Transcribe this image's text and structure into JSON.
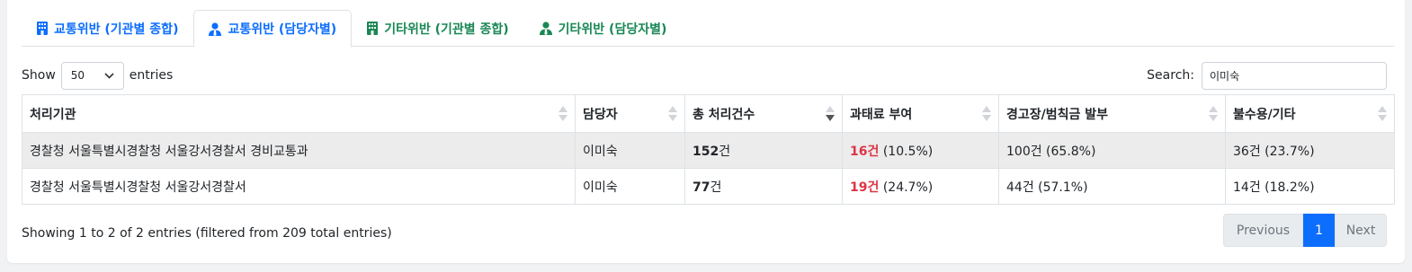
{
  "tabs": [
    {
      "label": "교통위반 (기관별 종합)",
      "icon": "building-icon",
      "color": "#0d6efd",
      "active": false
    },
    {
      "label": "교통위반 (담당자별)",
      "icon": "user-tie-icon",
      "color": "#0d6efd",
      "active": true
    },
    {
      "label": "기타위반 (기관별 종합)",
      "icon": "building-icon",
      "color": "#198754",
      "active": false
    },
    {
      "label": "기타위반 (담당자별)",
      "icon": "user-tie-icon",
      "color": "#198754",
      "active": false
    }
  ],
  "length": {
    "show": "Show",
    "value": "50",
    "entries": "entries"
  },
  "search": {
    "label": "Search:",
    "value": "이미숙"
  },
  "table": {
    "columns": [
      "처리기관",
      "담당자",
      "총 처리건수",
      "과태료 부여",
      "경고장/범칙금 발부",
      "불수용/기타"
    ],
    "sorted_column": "총 처리건수",
    "sort_direction": "desc",
    "rows": [
      {
        "agency": "경찰청 서울특별시경찰청 서울강서경찰서 경비교통과",
        "officer": "이미숙",
        "total_num": "152",
        "total_unit": "건",
        "fine_val": "16건",
        "fine_pct": " (10.5%)",
        "warning": "100건 (65.8%)",
        "reject": "36건 (23.7%)"
      },
      {
        "agency": "경찰청 서울특별시경찰청 서울강서경찰서",
        "officer": "이미숙",
        "total_num": "77",
        "total_unit": "건",
        "fine_val": "19건",
        "fine_pct": " (24.7%)",
        "warning": "44건 (57.1%)",
        "reject": "14건 (18.2%)"
      }
    ]
  },
  "info": "Showing 1 to 2 of 2 entries (filtered from 209 total entries)",
  "pagination": {
    "previous": "Previous",
    "current": "1",
    "next": "Next"
  },
  "colors": {
    "accent": "#0d6efd",
    "green": "#198754",
    "red": "#dc3545"
  }
}
